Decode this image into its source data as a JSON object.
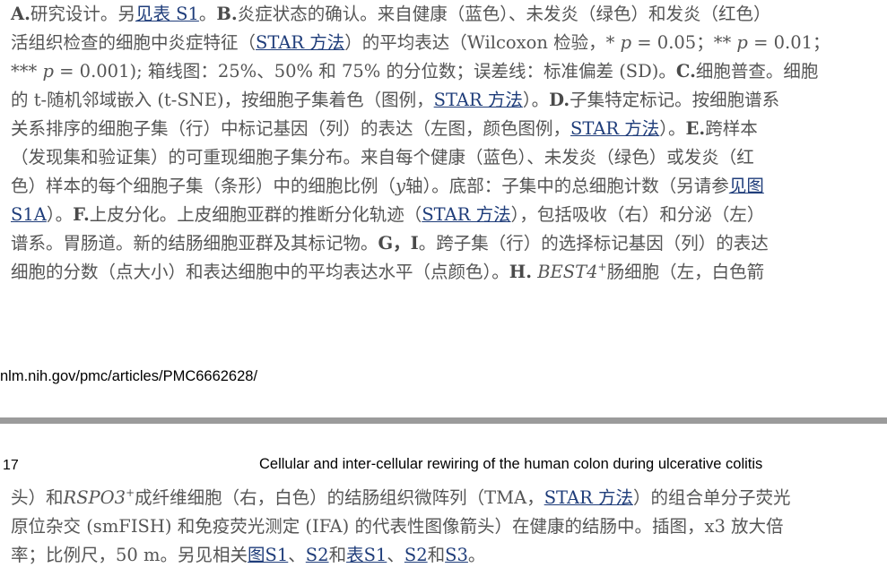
{
  "top": {
    "l1": {
      "label_a": "A.",
      "t1": "研究设计。另",
      "link1": "见表 S1",
      "t2": "。",
      "label_b": "B.",
      "t3": "炎症状态的确认。来自健康（蓝色）、未发炎（绿色）和发炎（红色）"
    },
    "l2": {
      "t1": "活组织检查的细胞中炎症特征（",
      "link1": "STAR 方法",
      "t2": "）的平均表达（Wilcoxon 检验，* ",
      "p1": "p",
      "t3": " = 0.05；** ",
      "p2": "p",
      "t4": " = 0.01；"
    },
    "l3": {
      "t1": "*** ",
      "p1": "p",
      "t2": " = 0.001); 箱线图：25%、50% 和 75% 的分位数；误差线：标准偏差 (SD)。",
      "label_c": "C.",
      "t3": "细胞普查。细胞"
    },
    "l4": {
      "t1": "的 t-随机邻域嵌入 (t-SNE)，按细胞子集着色（图例，",
      "link1": "STAR 方法",
      "t2": "）。",
      "label_d": "D.",
      "t3": "子集特定标记。按细胞谱系"
    },
    "l5": {
      "t1": "关系排序的细胞子集（行）中标记基因（列）的表达（左图，颜色图例，",
      "link1": "STAR 方法",
      "t2": "）。",
      "label_e": "E.",
      "t3": "跨样本"
    },
    "l6": {
      "t1": "（发现集和验证集）的可重现细胞子集分布。来自每个健康（蓝色）、未发炎（绿色）或发炎（红"
    },
    "l7": {
      "t1": "色）样本的每个细胞子集（条形）中的细胞比例（",
      "y": "y",
      "t2": "轴）。底部：子集中的总细胞计数（另请参",
      "link1": "见图"
    },
    "l8": {
      "link1": "S1A",
      "t1": "）。",
      "label_f": "F.",
      "t2": "上皮分化。上皮细胞亚群的推断分化轨迹（",
      "link2": "STAR 方法",
      "t3": "），包括吸收（右）和分泌（左）"
    },
    "l9": {
      "t1": "谱系。胃肠道。新的结肠细胞亚群及其标记物。",
      "label_gi": "G，I",
      "t2": "。跨子集（行）的选择标记基因（列）的表达"
    },
    "l10": {
      "t1": "细胞的分数（点大小）和表达细胞中的平均表达水平（点颜色）。",
      "label_h": "H.",
      "gene": "BEST4",
      "sup": "+",
      "t2": "肠细胞（左，白色箭"
    }
  },
  "url_line": "nlm.nih.gov/pmc/articles/PMC6662628/",
  "page_number": "17",
  "running_header": "Cellular and inter-cellular rewiring of the human colon during ulcerative colitis",
  "bottom": {
    "l1": {
      "t1": "头）和",
      "gene": "RSPO3",
      "sup": "+",
      "t2": "成纤维细胞（右，白色）的结肠组织微阵列（TMA，",
      "link1": "STAR 方法",
      "t3": "）的组合单分子荧光"
    },
    "l2": {
      "t1": "原位杂交 (smFISH) 和免疫荧光测定 (IFA) 的代表性图像箭头）在健康的结肠中。插图，x3 放大倍"
    },
    "l3": {
      "t1": "率；比例尺，50 m。另见相关",
      "link1": "图S1",
      "sep1": "、",
      "link2": "S2",
      "t2": "和",
      "link3": "表S1",
      "sep2": "、",
      "link4": "S2",
      "t3": "和",
      "link5": "S3",
      "t4": "。"
    }
  }
}
